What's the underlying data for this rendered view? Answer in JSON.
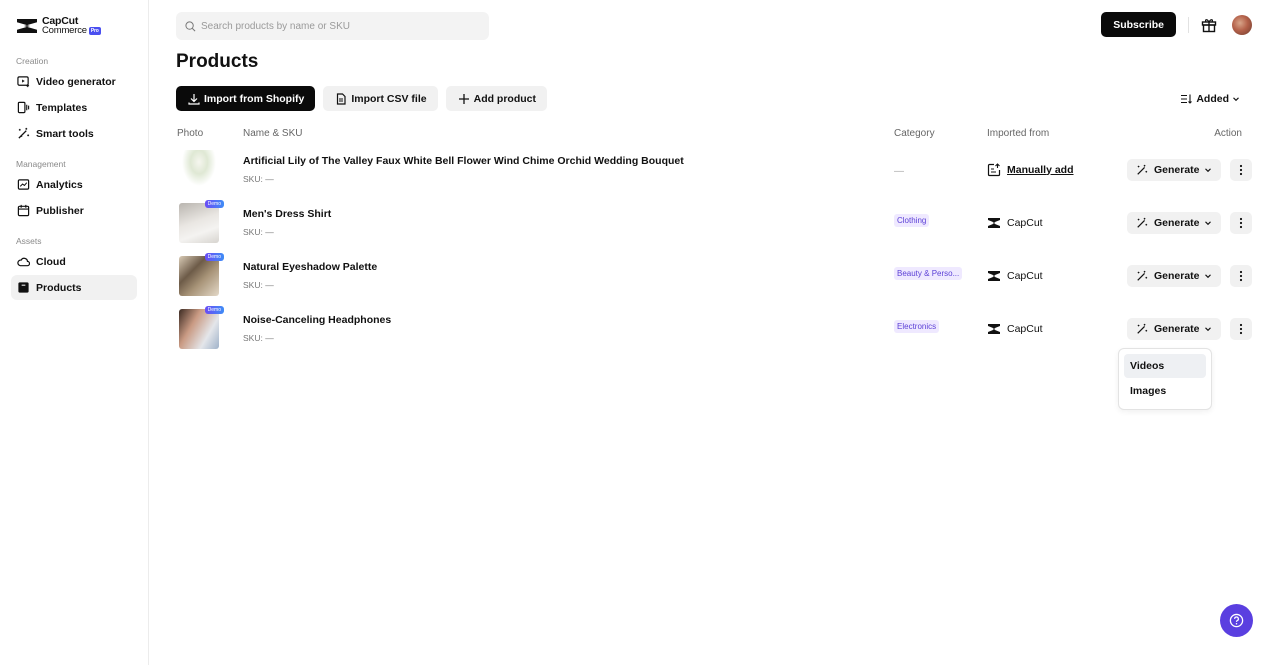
{
  "brand": {
    "name_line1": "CapCut",
    "name_line2": "Commerce",
    "badge": "Pro"
  },
  "sidebar": {
    "sections": [
      {
        "label": "Creation",
        "items": [
          {
            "label": "Video generator",
            "icon": "video-generator-icon"
          },
          {
            "label": "Templates",
            "icon": "templates-icon"
          },
          {
            "label": "Smart tools",
            "icon": "magic-wand-icon"
          }
        ]
      },
      {
        "label": "Management",
        "items": [
          {
            "label": "Analytics",
            "icon": "analytics-icon"
          },
          {
            "label": "Publisher",
            "icon": "calendar-icon"
          }
        ]
      },
      {
        "label": "Assets",
        "items": [
          {
            "label": "Cloud",
            "icon": "cloud-icon"
          },
          {
            "label": "Products",
            "icon": "products-icon",
            "active": true
          }
        ]
      }
    ]
  },
  "search": {
    "placeholder": "Search products by name or SKU",
    "value": ""
  },
  "topbar": {
    "subscribe_label": "Subscribe"
  },
  "page": {
    "title": "Products"
  },
  "toolbar": {
    "import_shopify": "Import from Shopify",
    "import_csv": "Import CSV file",
    "add_product": "Add product",
    "sort_label": "Added"
  },
  "table": {
    "headers": {
      "photo": "Photo",
      "name": "Name & SKU",
      "category": "Category",
      "imported": "Imported from",
      "action": "Action"
    },
    "rows": [
      {
        "name": "Artificial Lily of The Valley Faux White Bell Flower Wind Chime Orchid Wedding Bouquet",
        "sku": "SKU: —",
        "category": "—",
        "has_category": false,
        "imported_from": "Manually add",
        "import_type": "manual",
        "demo": false,
        "generate": "Generate"
      },
      {
        "name": "Men's Dress Shirt",
        "sku": "SKU: —",
        "category": "Clothing",
        "has_category": true,
        "imported_from": "CapCut",
        "import_type": "capcut",
        "demo": true,
        "demo_label": "Demo",
        "generate": "Generate"
      },
      {
        "name": "Natural Eyeshadow Palette",
        "sku": "SKU: —",
        "category": "Beauty & Perso...",
        "has_category": true,
        "imported_from": "CapCut",
        "import_type": "capcut",
        "demo": true,
        "demo_label": "Demo",
        "generate": "Generate"
      },
      {
        "name": "Noise-Canceling Headphones",
        "sku": "SKU: —",
        "category": "Electronics",
        "has_category": true,
        "imported_from": "CapCut",
        "import_type": "capcut",
        "demo": true,
        "demo_label": "Demo",
        "generate": "Generate"
      }
    ]
  },
  "generate_menu": {
    "items": [
      "Videos",
      "Images"
    ],
    "highlighted": "Videos"
  },
  "colors": {
    "accent": "#5a3fe0",
    "pill_bg": "#efe9ff",
    "pill_text": "#5b3fd6",
    "primary_btn": "#0a0a0a"
  }
}
